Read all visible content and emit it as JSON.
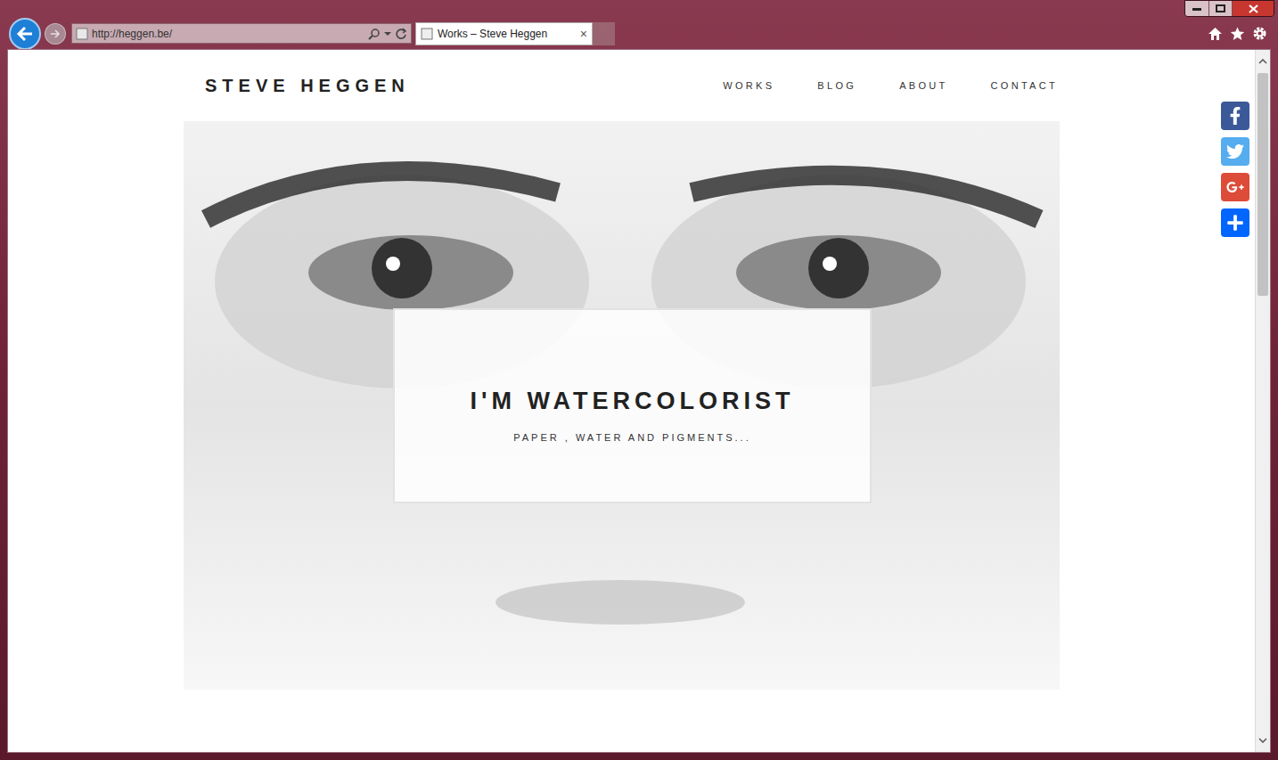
{
  "browser": {
    "address": "http://heggen.be/",
    "tab": {
      "title": "Works – Steve Heggen",
      "close": "×"
    }
  },
  "site": {
    "logo": "STEVE HEGGEN",
    "nav": [
      {
        "label": "WORKS"
      },
      {
        "label": "BLOG"
      },
      {
        "label": "ABOUT"
      },
      {
        "label": "CONTACT"
      }
    ]
  },
  "hero": {
    "title": "I'M WATERCOLORIST",
    "subtitle": "PAPER , WATER AND PIGMENTS..."
  },
  "share": [
    {
      "kind": "facebook",
      "color": "#3b5998"
    },
    {
      "kind": "twitter",
      "color": "#55acee"
    },
    {
      "kind": "googleplus",
      "color": "#dd4b39"
    },
    {
      "kind": "share",
      "color": "#0166ff"
    }
  ],
  "scrollbar": {
    "level": 0.34
  }
}
